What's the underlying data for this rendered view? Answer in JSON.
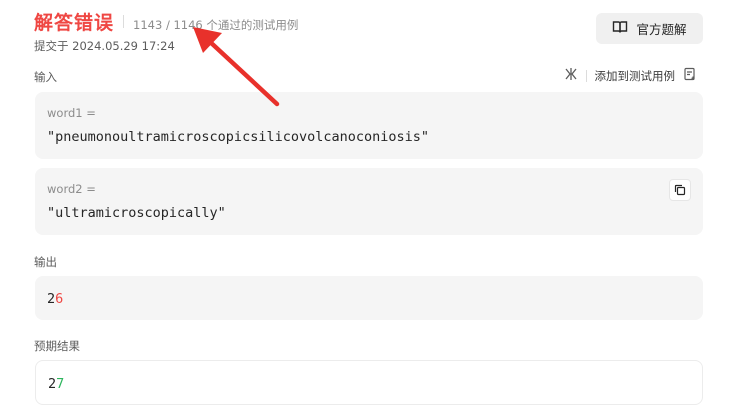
{
  "header": {
    "result_title": "解答错误",
    "pass_count": "1143 / 1146 个通过的测试用例",
    "submitted": "提交于 2024.05.29 17:24"
  },
  "official_button": {
    "label": "官方题解",
    "icon": "book-icon"
  },
  "input_section": {
    "label": "输入",
    "tools": {
      "add_label": "添加到测试用例"
    }
  },
  "inputs": [
    {
      "name": "word1 =",
      "value": "\"pneumonoultramicroscopicsilicovolcanoconiosis\""
    },
    {
      "name": "word2 =",
      "value": "\"ultramicroscopically\""
    }
  ],
  "output_section": {
    "label": "输出",
    "value_common": "2",
    "value_diff": "6"
  },
  "expected_section": {
    "label": "预期结果",
    "value_common": "2",
    "value_diff": "7"
  },
  "colors": {
    "error": "#ef4743",
    "success": "#2db55d",
    "annotation_arrow": "#e8312b"
  }
}
